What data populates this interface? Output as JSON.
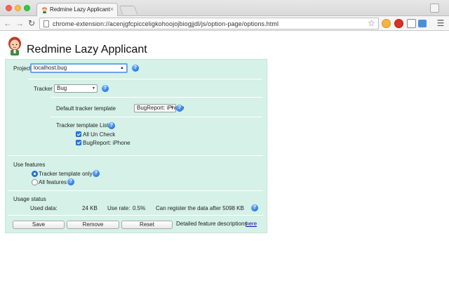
{
  "browser": {
    "tab_title": "Redmine Lazy Applicant",
    "tab_close": "×",
    "url": "chrome-extension://acenjgfcpicceligkohoojojbiogjjdl/js/option-page/options.html",
    "nav_icons": [
      "back-icon",
      "forward-icon",
      "reload-icon"
    ],
    "extension_icons": [
      "cookie-icon",
      "lastpass-icon",
      "bookmark-icon",
      "camera-icon",
      "screenshot-icon",
      "menu-icon"
    ]
  },
  "app": {
    "title": "Redmine Lazy Applicant"
  },
  "form": {
    "project": {
      "label": "Project",
      "value": "localhost.bug",
      "help": "?"
    },
    "tracker": {
      "label": "Tracker",
      "value": "Bug",
      "help": "?"
    },
    "default_template": {
      "label": "Default tracker template",
      "value": "BugReport: iPhone",
      "help": "?"
    },
    "template_list": {
      "label": "Tracker template List",
      "help": "?",
      "items": [
        {
          "label": "All Un Check",
          "checked": true
        },
        {
          "label": "BugReport: iPhone",
          "checked": true
        }
      ]
    },
    "use_features": {
      "label": "Use features",
      "options": [
        {
          "label": "Tracker template only",
          "selected": true,
          "help": "?"
        },
        {
          "label": "All features",
          "selected": false,
          "help": "?"
        }
      ]
    },
    "usage": {
      "label": "Usage status",
      "used_label": "Used data:",
      "used_value": "24 KB",
      "rate_label": "Use rate:",
      "rate_value": "0.5%",
      "register_text": "Can register the data after 5098 KB",
      "help": "?"
    },
    "buttons": {
      "save": "Save",
      "remove": "Remove",
      "reset": "Reset"
    },
    "footer": {
      "text": "Detailed feature descriptions",
      "link": "here"
    }
  },
  "colors": {
    "panel_bg": "#d5f1e8",
    "accent": "#2a7cf0",
    "link": "#1a0dab"
  }
}
